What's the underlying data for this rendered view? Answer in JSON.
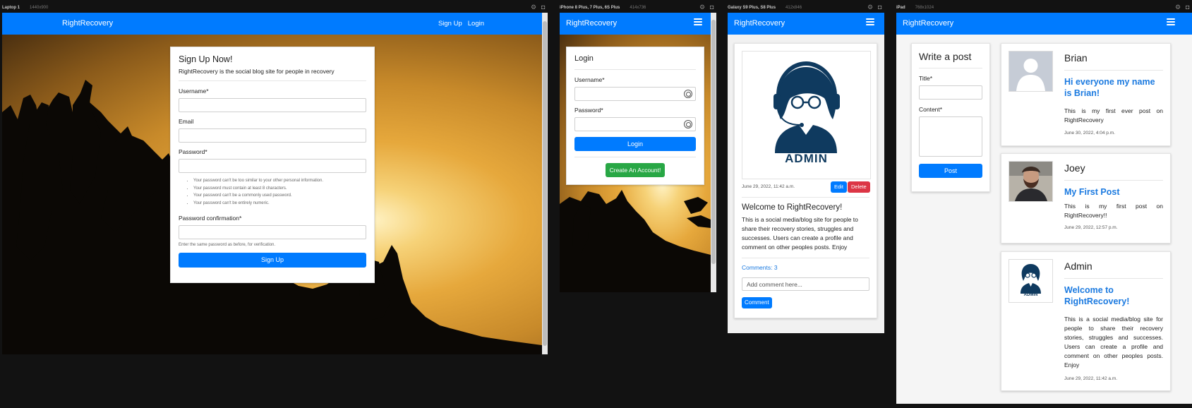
{
  "devices": [
    {
      "name": "Laptop 1",
      "dims": "1440x900"
    },
    {
      "name": "iPhone 8 Plus, 7 Plus, 6S Plus",
      "dims": "414x736"
    },
    {
      "name": "Galaxy S9 Plus, S8 Plus",
      "dims": "412x846"
    },
    {
      "name": "iPad",
      "dims": "768x1024"
    }
  ],
  "brand": "RightRecovery",
  "nav": {
    "signup": "Sign Up",
    "login": "Login"
  },
  "signup": {
    "title": "Sign Up Now!",
    "subtitle": "RightRecovery is the social blog site for people in recovery",
    "username_label": "Username*",
    "email_label": "Email",
    "password_label": "Password*",
    "password_help": [
      "Your password can't be too similar to your other personal information.",
      "Your password must contain at least 8 characters.",
      "Your password can't be a commonly used password.",
      "Your password can't be entirely numeric."
    ],
    "confirm_label": "Password confirmation*",
    "confirm_help": "Enter the same password as before, for verification.",
    "submit": "Sign Up"
  },
  "login": {
    "title": "Login",
    "username_label": "Username*",
    "password_label": "Password*",
    "submit": "Login",
    "create": "Create An Account!"
  },
  "post_detail": {
    "image_text": "ADMIN",
    "date": "June 29, 2022, 11:42 a.m.",
    "edit": "Edit",
    "delete": "Delete",
    "title": "Welcome to RightRecovery!",
    "body": "This is a social media/blog site for people to share their recovery stories, struggles and successes. Users can create a profile and comment on other peoples posts. Enjoy",
    "comments": "Comments: 3",
    "comment_placeholder": "Add comment here...",
    "comment_button": "Comment"
  },
  "write_post": {
    "title": "Write a post",
    "title_label": "Title*",
    "content_label": "Content*",
    "submit": "Post"
  },
  "feed": [
    {
      "author": "Brian",
      "title": "Hi everyone my name is Brian!",
      "body": "This is my first ever post on RightRecovery",
      "date": "June 30, 2022, 4:04 p.m."
    },
    {
      "author": "Joey",
      "title": "My First Post",
      "body": "This is my first post on RightRecovery!!",
      "date": "June 29, 2022, 12:57 p.m."
    },
    {
      "author": "Admin",
      "title": "Welcome to RightRecovery!",
      "body": "This is a social media/blog site for people to share their recovery stories, struggles and successes. Users can create a profile and comment on other peoples posts. Enjoy",
      "date": "June 29, 2022, 11:42 a.m.",
      "avatar_text": "ADMIN"
    }
  ],
  "colors": {
    "primary": "#007bff",
    "success": "#28a745",
    "danger": "#dc3545",
    "admin_navy": "#0f3a5f"
  }
}
